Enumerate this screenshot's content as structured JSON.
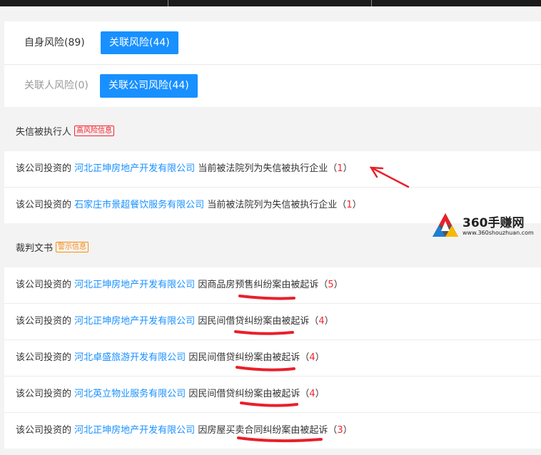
{
  "tabs_row1": [
    {
      "label": "自身风险(89)",
      "active": false
    },
    {
      "label": "关联风险(44)",
      "active": true
    }
  ],
  "tabs_row2": [
    {
      "label": "关联人风险(0)",
      "active": false
    },
    {
      "label": "关联公司风险(44)",
      "active": true
    }
  ],
  "section1": {
    "title": "失信被执行人",
    "badge": "高风险信息",
    "items": [
      {
        "prefix": "该公司投资的",
        "company": "河北正坤房地产开发有限公司",
        "desc": "当前被法院列为失信被执行企业",
        "count": "1"
      },
      {
        "prefix": "该公司投资的",
        "company": "石家庄市景超餐饮服务有限公司",
        "desc": "当前被法院列为失信被执行企业",
        "count": "1"
      }
    ]
  },
  "section2": {
    "title": "裁判文书",
    "badge": "警示信息",
    "items": [
      {
        "prefix": "该公司投资的",
        "company": "河北正坤房地产开发有限公司",
        "desc": "因商品房预售纠纷案由被起诉",
        "count": "5"
      },
      {
        "prefix": "该公司投资的",
        "company": "河北正坤房地产开发有限公司",
        "desc": "因民间借贷纠纷案由被起诉",
        "count": "4"
      },
      {
        "prefix": "该公司投资的",
        "company": "河北卓盛旅游开发有限公司",
        "desc": "因民间借贷纠纷案由被起诉",
        "count": "4"
      },
      {
        "prefix": "该公司投资的",
        "company": "河北英立物业服务有限公司",
        "desc": "因民间借贷纠纷案由被起诉",
        "count": "4"
      },
      {
        "prefix": "该公司投资的",
        "company": "河北正坤房地产开发有限公司",
        "desc": "因房屋买卖合同纠纷案由被起诉",
        "count": "3"
      }
    ]
  },
  "watermark": {
    "brand": "360手赚网",
    "domain": "www.360shouzhuan.com"
  },
  "paren_open": "（",
  "paren_close": "）",
  "colors": {
    "accent": "#1890ff",
    "danger": "#f5222d",
    "warning": "#fa8c16",
    "annotation": "#e8202a"
  }
}
